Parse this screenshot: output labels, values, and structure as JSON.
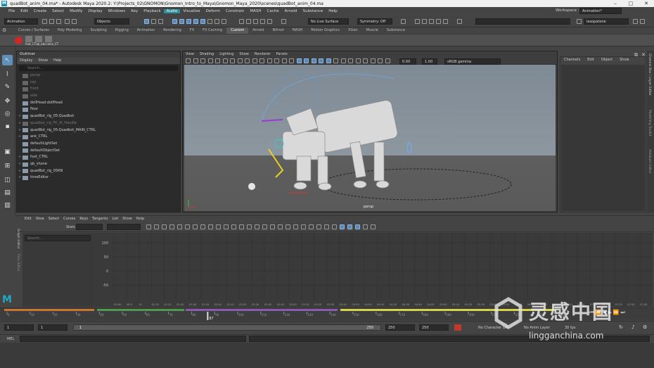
{
  "window": {
    "title": "quadBot_anim_04.ma* - Autodesk Maya 2020.2: Y:\\Projects_02\\GNOMON\\Gnomon_Intro_to_Maya\\Gnomon_Maya_2020\\scenes\\quadBot_anim_04.ma",
    "logo": "M"
  },
  "menubar": [
    "File",
    "Edit",
    "Create",
    "Select",
    "Modify",
    "Display",
    "Windows",
    "Key",
    "Playback",
    "Audio",
    "Visualize",
    "Deform",
    "Constrain",
    "MASH",
    "Cache",
    "Arnold",
    "Substance",
    "Help"
  ],
  "menubar_active": "Audio",
  "workspace": {
    "label": "Workspace :",
    "value": "Animation*"
  },
  "statusline": {
    "menuset": "Animation",
    "select_mode": "Objects",
    "live_surface": "No Live Surface",
    "symmetry": "Symmetry: Off",
    "user": "lasopatone"
  },
  "shelf_tabs": [
    "Curves / Surfaces",
    "Poly Modeling",
    "Sculpting",
    "Rigging",
    "Animation",
    "Rendering",
    "FX",
    "FX Caching",
    "Custom",
    "Arnold",
    "Bifrost",
    "MASH",
    "Motion Graphics",
    "XGen",
    "Muscle",
    "Substance"
  ],
  "shelf_active": "Custom",
  "shelf_item": "foot_CTqb_abccams_CT",
  "outliner": {
    "title": "Outliner",
    "menu": [
      "Display",
      "Show",
      "Help"
    ],
    "search_placeholder": "Search...",
    "items": [
      {
        "label": "persp",
        "dim": true,
        "expander": ""
      },
      {
        "label": "top",
        "dim": true,
        "expander": ""
      },
      {
        "label": "front",
        "dim": true,
        "expander": ""
      },
      {
        "label": "side",
        "dim": true,
        "expander": ""
      },
      {
        "label": "dollHead:dollHead",
        "dim": false,
        "expander": ""
      },
      {
        "label": "floor",
        "dim": false,
        "expander": ""
      },
      {
        "label": "quadBot_rig_05:Quadbot",
        "dim": false,
        "expander": "+"
      },
      {
        "label": "quadbot_rig_FK_IK_Handle",
        "dim": true,
        "expander": "+"
      },
      {
        "label": "quadBot_rig_05:Quadbot_MAIN_CTRL",
        "dim": false,
        "expander": "+"
      },
      {
        "label": "ank_CTRL",
        "dim": false,
        "expander": "+"
      },
      {
        "label": "defaultLightSet",
        "dim": false,
        "expander": ""
      },
      {
        "label": "defaultObjectSet",
        "dim": false,
        "expander": ""
      },
      {
        "label": "foot_CTRL",
        "dim": false,
        "expander": "+"
      },
      {
        "label": "qb_shone",
        "dim": false,
        "expander": "+"
      },
      {
        "label": "quadBot_rig_05RN",
        "dim": false,
        "expander": "+"
      },
      {
        "label": "timeEditor",
        "dim": false,
        "expander": "+"
      }
    ]
  },
  "viewport": {
    "menu": [
      "View",
      "Shading",
      "Lighting",
      "Show",
      "Renderer",
      "Panels"
    ],
    "exposure": "0.00",
    "gamma": "1.00",
    "colorspace": "sRGB gamma",
    "camera_label": "persp"
  },
  "channelbox": {
    "menu": [
      "Channels",
      "Edit",
      "Object",
      "Show"
    ],
    "side_tabs": [
      "Channel Box / Layer Editor",
      "Modelling Toolkit",
      "Attribute Editor"
    ]
  },
  "graph_editor": {
    "menu": [
      "Edit",
      "View",
      "Select",
      "Curves",
      "Keys",
      "Tangents",
      "List",
      "Show",
      "Help"
    ],
    "stats_label": "Stats",
    "search_placeholder": "Search...",
    "side_label": "Graph Editor",
    "side_label2": "Time Editor",
    "y_ticks": [
      "100",
      "50",
      "0",
      "-50"
    ],
    "x_ticks": [
      "00:00",
      "00:5",
      "01",
      "01:10",
      "01:20",
      "01:30",
      "01:40",
      "01:50",
      "02:00",
      "02:10",
      "02:20",
      "02:30",
      "02:40",
      "02:50",
      "03:00",
      "03:10",
      "03:20",
      "03:30",
      "03:40",
      "03:50",
      "04:00",
      "04:10",
      "04:20",
      "04:30",
      "04:40",
      "04:50",
      "05:00",
      "05:10",
      "05:20",
      "05:30",
      "05:40",
      "05:50",
      "06:00",
      "06:10",
      "06:20",
      "06:30",
      "06:40",
      "06:50",
      "07:00",
      "07:10",
      "07:20",
      "07:30",
      "07:40"
    ]
  },
  "timeslider": {
    "ticks": [
      "0",
      "10",
      "20",
      "30",
      "40",
      "50",
      "60",
      "70",
      "80",
      "90",
      "100",
      "110",
      "120",
      "130",
      "140",
      "150",
      "160",
      "170",
      "180",
      "190",
      "200",
      "210",
      "220",
      "230",
      "240"
    ],
    "current_frame": "87",
    "colors": [
      "#c8762e",
      "#4c9c4c",
      "#8a5ab0",
      "#d6d24a"
    ]
  },
  "rangeslider": {
    "start": "1",
    "start_inner": "1",
    "range_start": "1",
    "range_end": "250",
    "end_inner": "250",
    "end": "250",
    "character_set": "No Character Set",
    "anim_layer": "No Anim Layer",
    "fps": "30 fps"
  },
  "cmdline": {
    "label": "MEL"
  },
  "watermark": {
    "text": "灵感中国",
    "url": "lingganchina.com"
  },
  "colors": {
    "accent": "#5d8fb8",
    "menu_highlight": "#2e8f9c"
  }
}
